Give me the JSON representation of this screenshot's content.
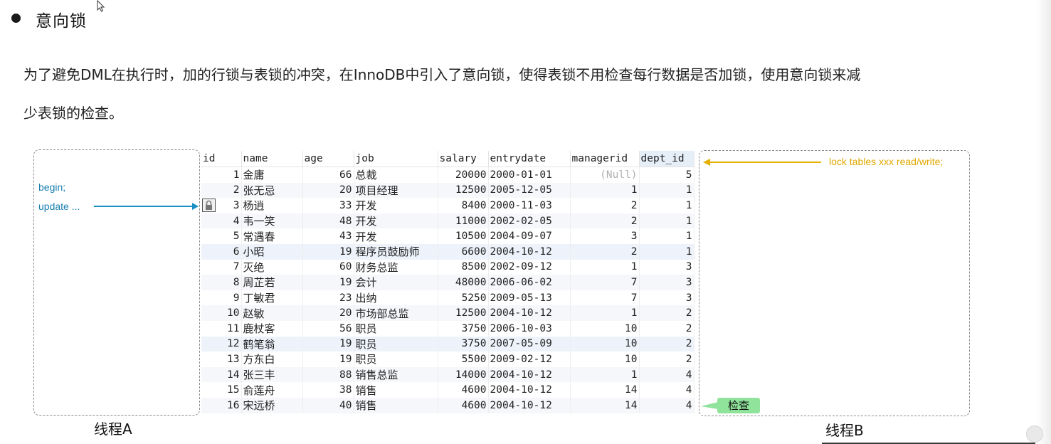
{
  "title": "意向锁",
  "paragraph_line1": "为了避免DML在执行时，加的行锁与表锁的冲突，在InnoDB中引入了意向锁，使得表锁不用检查每行数据是否加锁，使用意向锁来减",
  "paragraph_line2": "少表锁的检查。",
  "thread_a": {
    "label": "线程A",
    "line1": "begin;",
    "line2": "update ..."
  },
  "thread_b": {
    "label": "线程B",
    "statement": "lock tables xxx read/write;",
    "check_badge": "检查"
  },
  "colors": {
    "thread_a_note": "#1a7fb0",
    "thread_b_note": "#e0a800",
    "check_badge": "#8fe39a"
  },
  "table": {
    "columns": [
      "id",
      "name",
      "age",
      "job",
      "salary",
      "entrydate",
      "managerid",
      "dept_id"
    ],
    "locked_row_index": 2,
    "rows": [
      [
        "1",
        "金庸",
        "66",
        "总裁",
        "20000",
        "2000-01-01",
        "(Null)",
        "5"
      ],
      [
        "2",
        "张无忌",
        "20",
        "项目经理",
        "12500",
        "2005-12-05",
        "1",
        "1"
      ],
      [
        "3",
        "杨逍",
        "33",
        "开发",
        "8400",
        "2000-11-03",
        "2",
        "1"
      ],
      [
        "4",
        "韦一笑",
        "48",
        "开发",
        "11000",
        "2002-02-05",
        "2",
        "1"
      ],
      [
        "5",
        "常遇春",
        "43",
        "开发",
        "10500",
        "2004-09-07",
        "3",
        "1"
      ],
      [
        "6",
        "小昭",
        "19",
        "程序员鼓励师",
        "6600",
        "2004-10-12",
        "2",
        "1"
      ],
      [
        "7",
        "灭绝",
        "60",
        "财务总监",
        "8500",
        "2002-09-12",
        "1",
        "3"
      ],
      [
        "8",
        "周芷若",
        "19",
        "会计",
        "48000",
        "2006-06-02",
        "7",
        "3"
      ],
      [
        "9",
        "丁敏君",
        "23",
        "出纳",
        "5250",
        "2009-05-13",
        "7",
        "3"
      ],
      [
        "10",
        "赵敏",
        "20",
        "市场部总监",
        "12500",
        "2004-10-12",
        "1",
        "2"
      ],
      [
        "11",
        "鹿杖客",
        "56",
        "职员",
        "3750",
        "2006-10-03",
        "10",
        "2"
      ],
      [
        "12",
        "鹤笔翁",
        "19",
        "职员",
        "3750",
        "2007-05-09",
        "10",
        "2"
      ],
      [
        "13",
        "方东白",
        "19",
        "职员",
        "5500",
        "2009-02-12",
        "10",
        "2"
      ],
      [
        "14",
        "张三丰",
        "88",
        "销售总监",
        "14000",
        "2004-10-12",
        "1",
        "4"
      ],
      [
        "15",
        "俞莲舟",
        "38",
        "销售",
        "4600",
        "2004-10-12",
        "14",
        "4"
      ],
      [
        "16",
        "宋远桥",
        "40",
        "销售",
        "4600",
        "2004-10-12",
        "14",
        "4"
      ]
    ]
  }
}
